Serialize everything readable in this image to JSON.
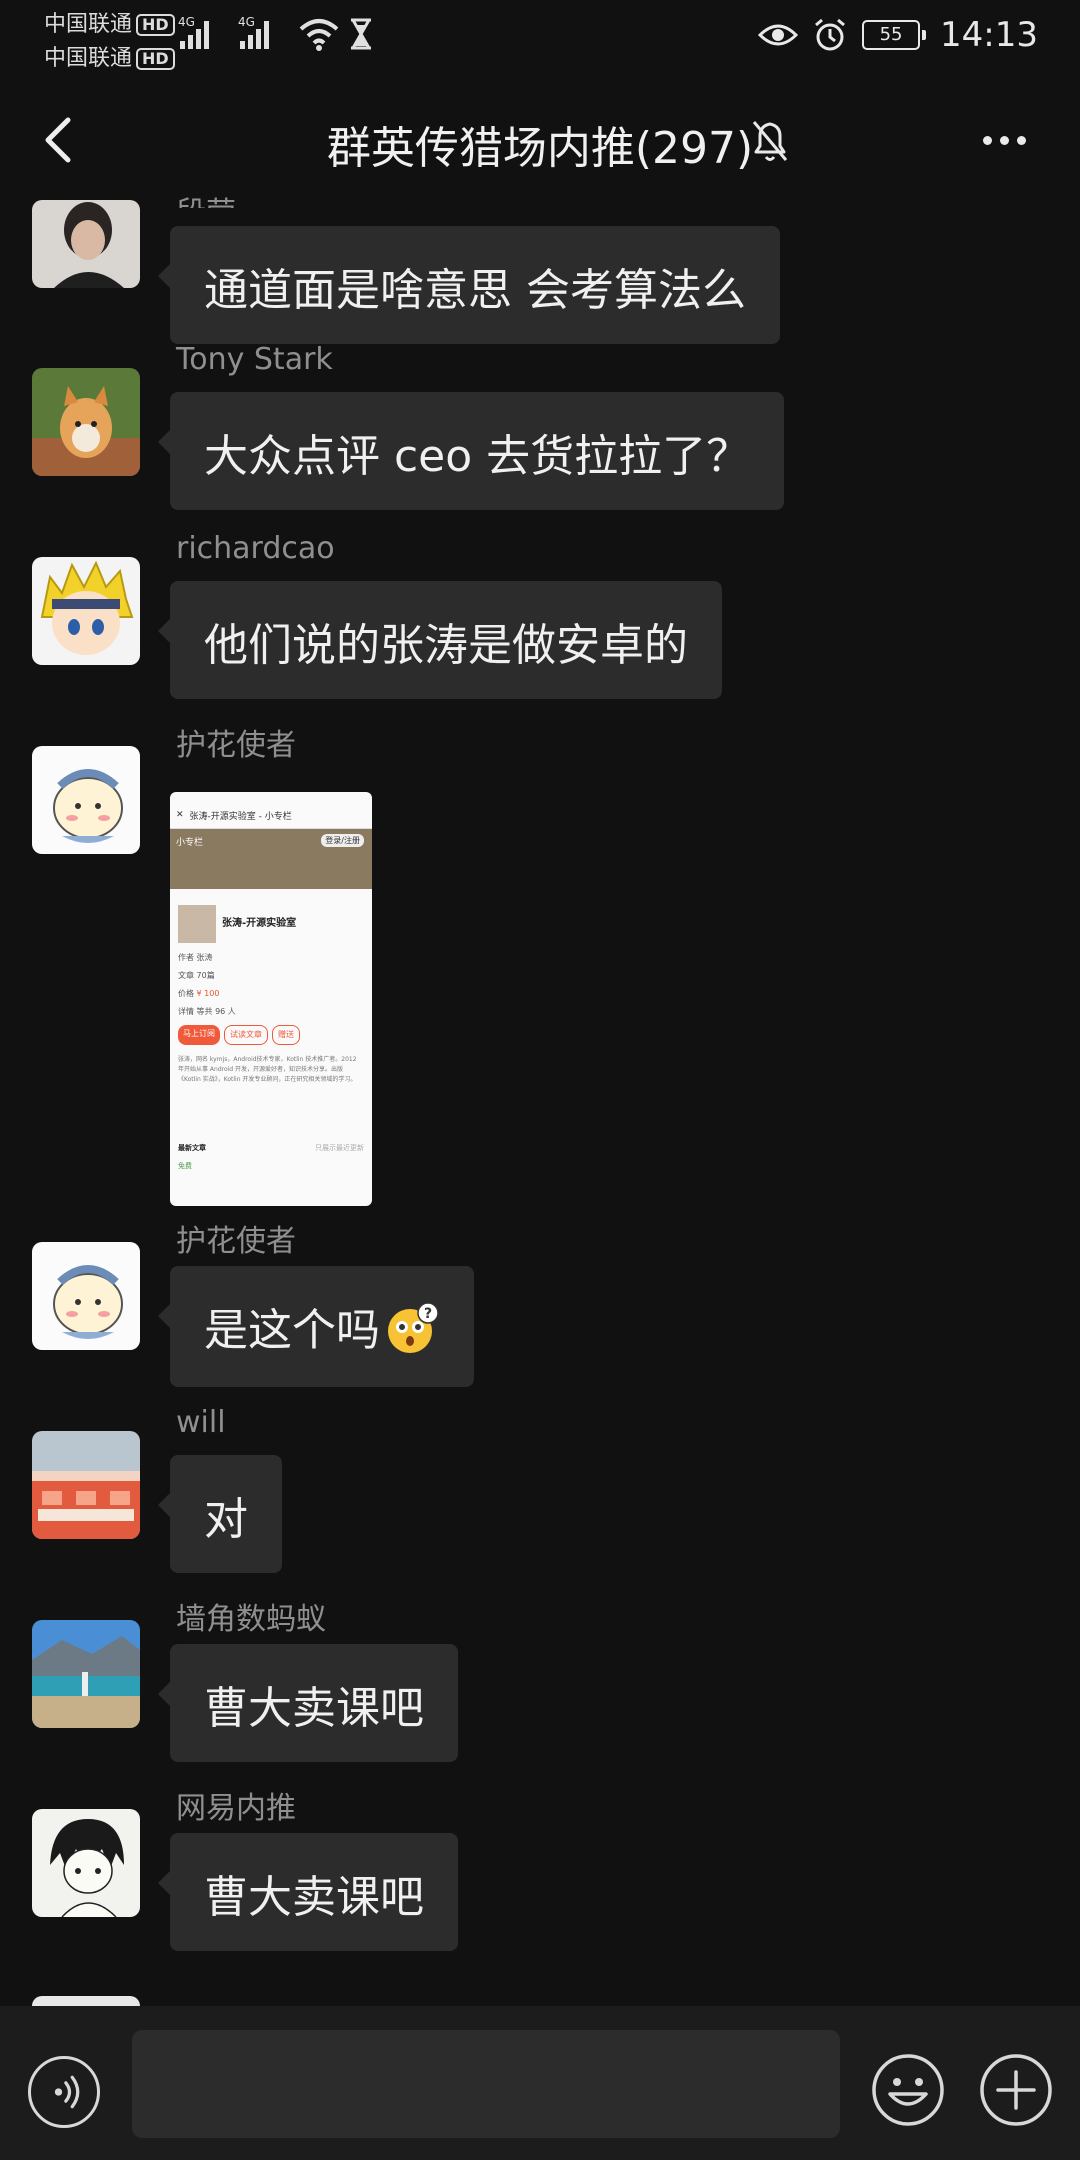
{
  "status_bar": {
    "carrier_1": "中国联通",
    "carrier_2": "中国联通",
    "hd": "HD",
    "net_1": "4G",
    "net_2": "4G",
    "battery": "55",
    "time": "14:13"
  },
  "chat": {
    "title": "群英传猎场内推(297)"
  },
  "messages": [
    {
      "sender": "段莹",
      "text": "通道面是啥意思  会考算法么"
    },
    {
      "sender": "Tony Stark",
      "text": "大众点评 ceo 去货拉拉了？"
    },
    {
      "sender": "richardcao",
      "text": "他们说的张涛是做安卓的"
    },
    {
      "sender": "护花使者",
      "image": {
        "header_title": "张涛-开源实验室 - 小专栏",
        "site": "小专栏",
        "login": "登录/注册",
        "profile_name": "张涛-开源实验室",
        "author_label": "作者",
        "author": "张涛",
        "articles_label": "文章",
        "articles": "70篇",
        "price_label": "价格",
        "price": "¥ 100",
        "detail_label": "详情",
        "subscribers": "等共 96 人",
        "subscribe_btn": "马上订阅",
        "trial_btn": "试读文章",
        "gift_btn": "赠送",
        "bio": "张涛，网名 kymjs，Android技术专家，Kotlin 技术推广者。2012 年开始从事 Android 开发，开源爱好者，知识技术分享。出版《Kotlin 实战》，Kotlin 开发专业顾问，正在研究相关领域的学习。",
        "section": "最新文章",
        "section_hint": "只展示最近更新",
        "badge": "免费"
      }
    },
    {
      "sender": "护花使者",
      "text": "是这个吗"
    },
    {
      "sender": "will",
      "text": "对"
    },
    {
      "sender": "墙角数蚂蚁",
      "text": "曹大卖课吧"
    },
    {
      "sender": "网易内推",
      "text": "曹大卖课吧"
    }
  ],
  "input": {
    "value": ""
  },
  "icons": [
    "back-arrow-icon",
    "mute-bell-icon",
    "more-dots-icon",
    "voice-icon",
    "emoji-icon",
    "plus-icon"
  ],
  "colors": {
    "background": "#111111",
    "bubble": "#2c2c2c",
    "bottom_bar": "#1c1c1c",
    "sender": "#8f8f8f"
  }
}
